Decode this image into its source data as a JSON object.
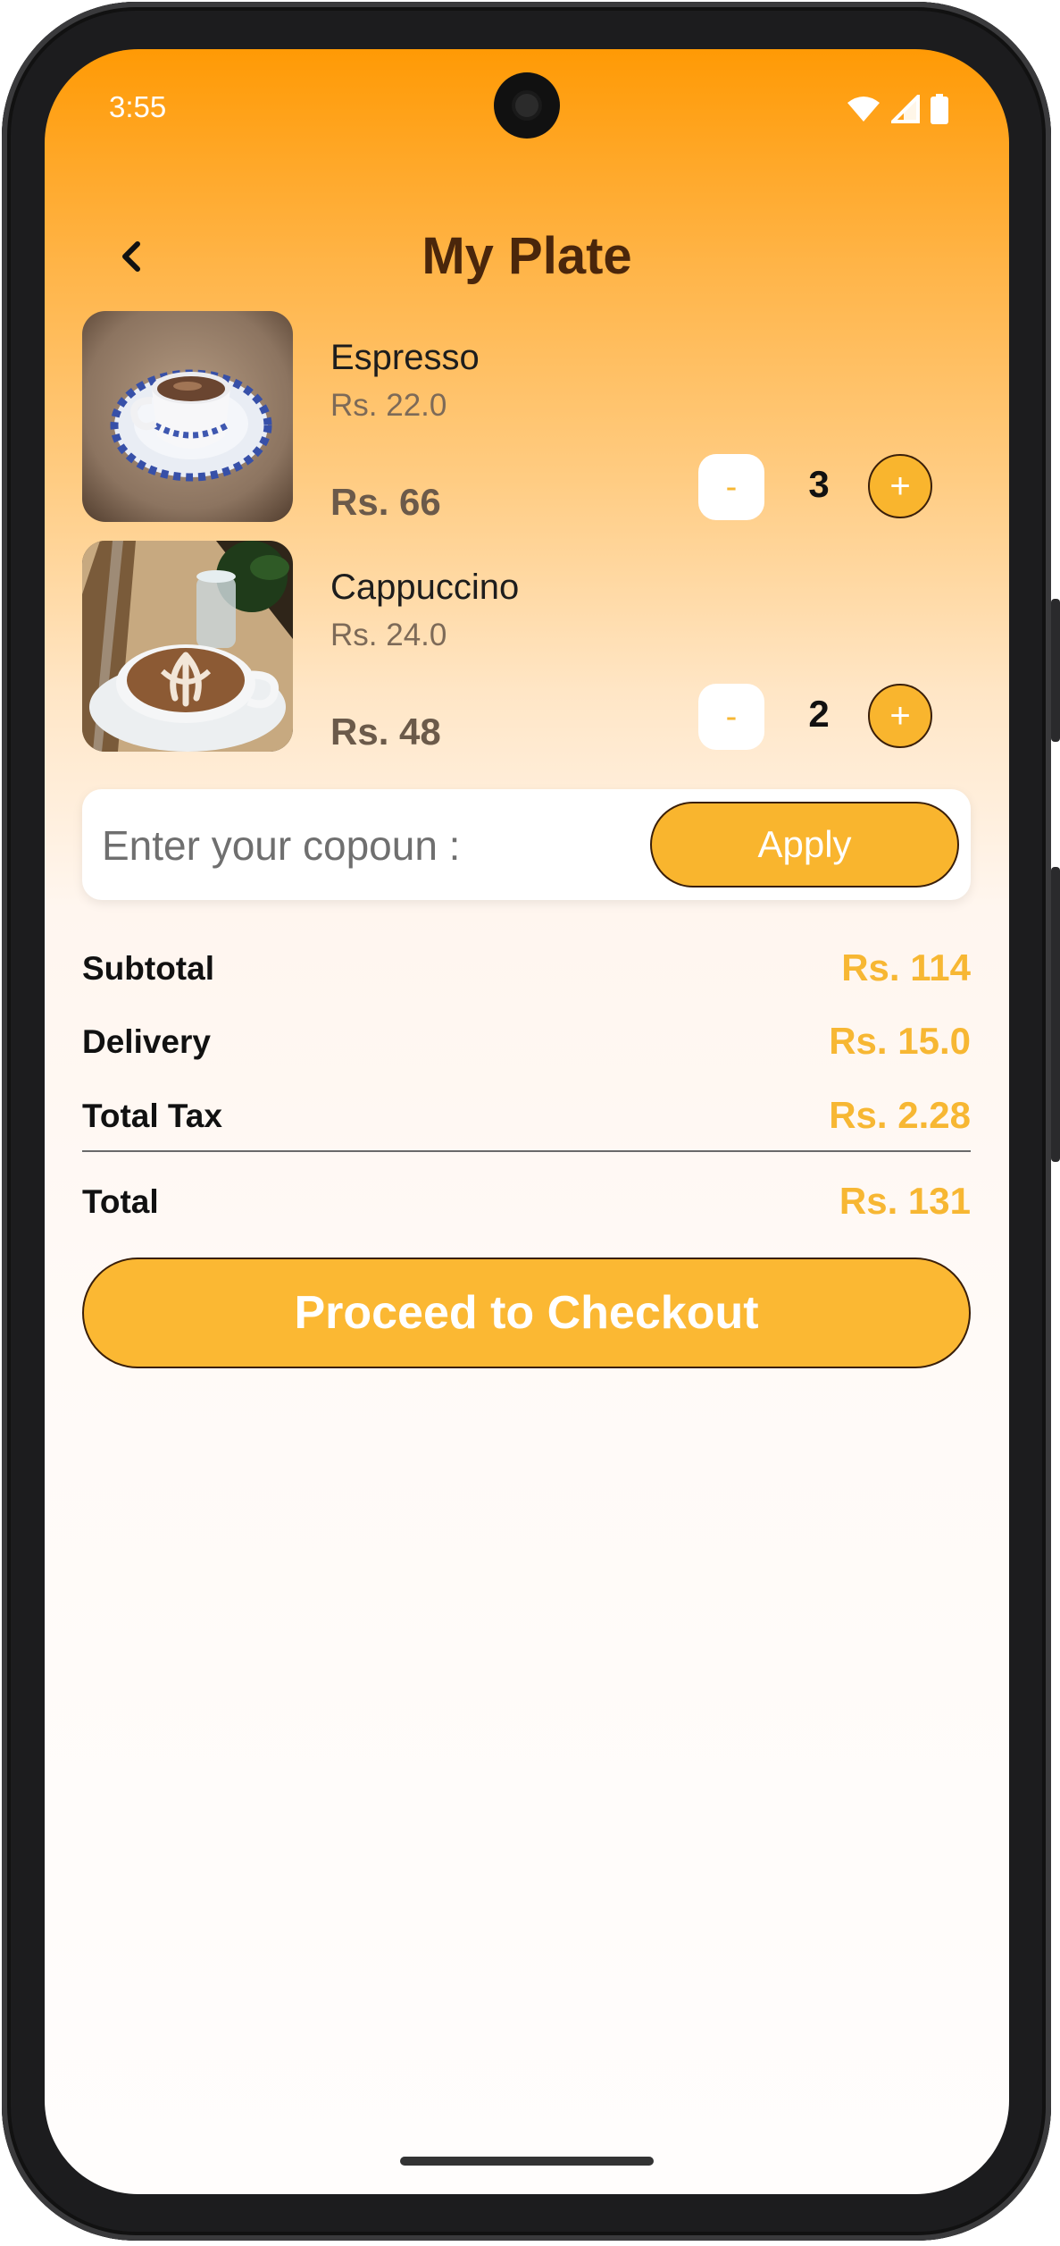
{
  "status_bar": {
    "time": "3:55"
  },
  "header": {
    "title": "My Plate"
  },
  "cart": {
    "items": [
      {
        "name": "Espresso",
        "unit_price": "Rs. 22.0",
        "line_total": "Rs. 66",
        "minus": "-",
        "quantity": "3",
        "plus": "+"
      },
      {
        "name": "Cappuccino",
        "unit_price": "Rs. 24.0",
        "line_total": "Rs. 48",
        "minus": "-",
        "quantity": "2",
        "plus": "+"
      }
    ]
  },
  "coupon": {
    "placeholder": "Enter your copoun :",
    "apply_label": "Apply"
  },
  "summary": {
    "subtotal_label": "Subtotal",
    "subtotal_value": "Rs. 114",
    "delivery_label": "Delivery",
    "delivery_value": "Rs. 15.0",
    "tax_label": "Total Tax",
    "tax_value": "Rs. 2.28",
    "total_label": "Total",
    "total_value": "Rs. 131"
  },
  "checkout": {
    "label": "Proceed to Checkout"
  },
  "colors": {
    "accent": "#f9b52e",
    "title": "#4a260b",
    "header_gradient_top": "#ff9a05"
  }
}
